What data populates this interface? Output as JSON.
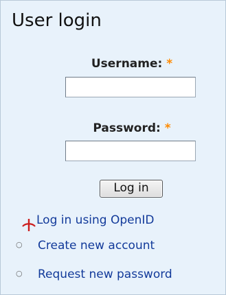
{
  "block": {
    "title": "User login"
  },
  "form": {
    "username_label": "Username:",
    "password_label": "Password:",
    "required_marker": "*",
    "username_value": "",
    "password_value": "",
    "submit_label": "Log in"
  },
  "links": {
    "openid": "Log in using OpenID",
    "create_account": "Create new account",
    "request_password": "Request new password",
    "bullet": "○"
  },
  "icons": {
    "openid": "openid-icon",
    "bullet": "circle-bullet-icon"
  },
  "colors": {
    "panel_bg": "#e8f2fb",
    "link": "#123a9a",
    "required": "#ff8a00",
    "openid_icon": "#cc1f1f"
  }
}
